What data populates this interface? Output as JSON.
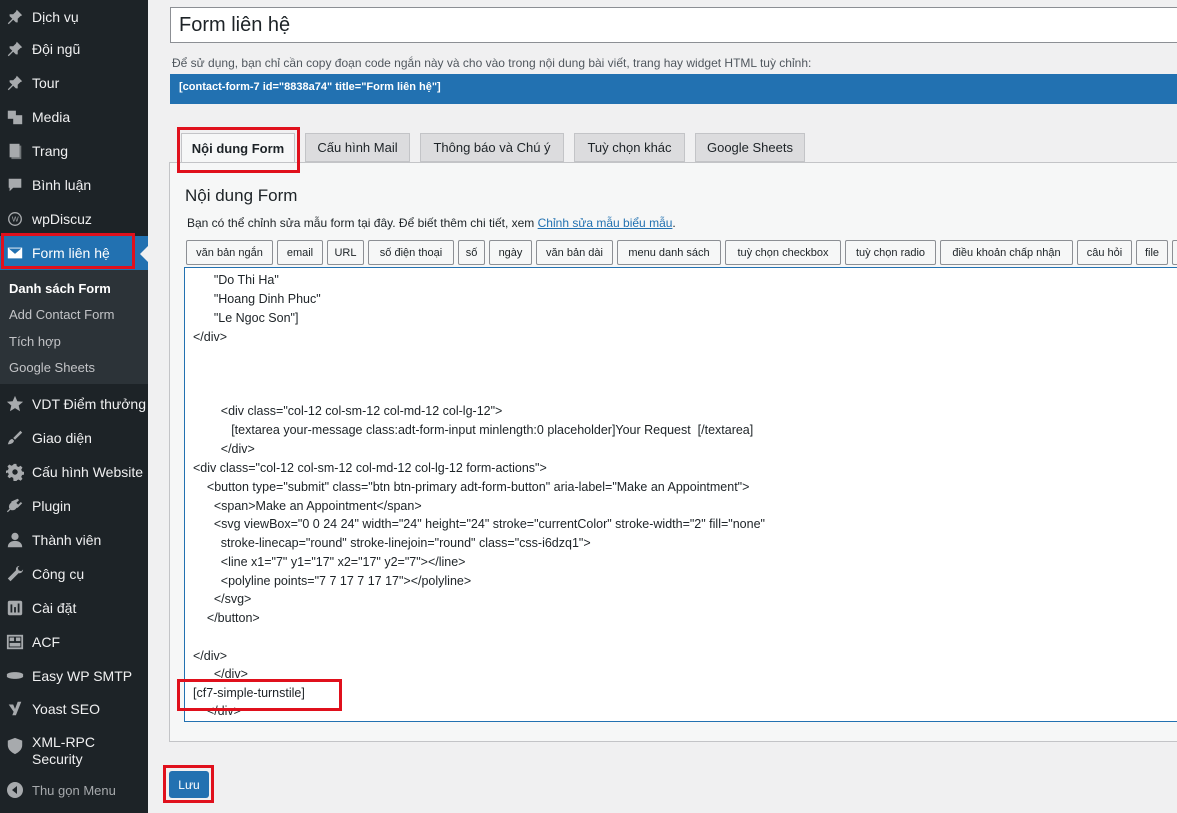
{
  "sidebar": {
    "items": [
      {
        "label": "Dịch vụ",
        "icon": "pin-icon"
      },
      {
        "label": "Đội ngũ",
        "icon": "pin-icon"
      },
      {
        "label": "Tour",
        "icon": "pin-icon"
      },
      {
        "label": "Media",
        "icon": "media-icon"
      },
      {
        "label": "Trang",
        "icon": "page-icon"
      },
      {
        "label": "Bình luận",
        "icon": "comment-icon"
      },
      {
        "label": "wpDiscuz",
        "icon": "wpdiscuz-icon"
      },
      {
        "label": "Form liên hệ",
        "icon": "mail-icon"
      },
      {
        "label": "VDT Điểm thưởng",
        "icon": "star-icon"
      },
      {
        "label": "Giao diện",
        "icon": "brush-icon"
      },
      {
        "label": "Cấu hình Website",
        "icon": "gear-icon"
      },
      {
        "label": "Plugin",
        "icon": "plugin-icon"
      },
      {
        "label": "Thành viên",
        "icon": "user-icon"
      },
      {
        "label": "Công cụ",
        "icon": "wrench-icon"
      },
      {
        "label": "Cài đặt",
        "icon": "settings-icon"
      },
      {
        "label": "ACF",
        "icon": "grid-icon"
      },
      {
        "label": "Easy WP SMTP",
        "icon": "smtp-icon"
      },
      {
        "label": "Yoast SEO",
        "icon": "yoast-icon"
      },
      {
        "label": "XML-RPC Security",
        "icon": "shield-icon"
      }
    ],
    "submenu": [
      "Danh sách Form",
      "Add Contact Form",
      "Tích hợp",
      "Google Sheets"
    ],
    "collapse_label": "Thu gọn Menu"
  },
  "form": {
    "title": "Form liên hệ",
    "shortcode_desc": "Để sử dụng, bạn chỉ cần copy đoạn code ngắn này và cho vào trong nội dung bài viết, trang hay widget HTML tuỳ chỉnh:",
    "shortcode": "[contact-form-7 id=\"8838a74\" title=\"Form liên hệ\"]"
  },
  "tabs": [
    "Nội dung Form",
    "Cấu hình Mail",
    "Thông báo và Chú ý",
    "Tuỳ chọn khác",
    "Google Sheets"
  ],
  "panel": {
    "title": "Nội dung Form",
    "desc_text": "Bạn có thể chỉnh sửa mẫu form tại đây. Để biết thêm chi tiết, xem ",
    "desc_link": "Chỉnh sửa mẫu biểu mẫu",
    "desc_end": "."
  },
  "tag_buttons": [
    "văn bản ngắn",
    "email",
    "URL",
    "số điện thoại",
    "số",
    "ngày",
    "văn bản dài",
    "menu danh sách",
    "tuỳ chọn checkbox",
    "tuỳ chọn radio",
    "điều khoản chấp nhận",
    "câu hỏi",
    "file"
  ],
  "code_lines": [
    "      \"Do Thi Ha\"",
    "      \"Hoang Dinh Phuc\"",
    "      \"Le Ngoc Son\"]",
    "</div>",
    "",
    "",
    "",
    "        <div class=\"col-12 col-sm-12 col-md-12 col-lg-12\">",
    "           [textarea your-message class:adt-form-input minlength:0 placeholder]Your Request  [/textarea]",
    "        </div>",
    "<div class=\"col-12 col-sm-12 col-md-12 col-lg-12 form-actions\">",
    "    <button type=\"submit\" class=\"btn btn-primary adt-form-button\" aria-label=\"Make an Appointment\">",
    "      <span>Make an Appointment</span>",
    "      <svg viewBox=\"0 0 24 24\" width=\"24\" height=\"24\" stroke=\"currentColor\" stroke-width=\"2\" fill=\"none\"",
    "        stroke-linecap=\"round\" stroke-linejoin=\"round\" class=\"css-i6dzq1\">",
    "        <line x1=\"7\" y1=\"17\" x2=\"17\" y2=\"7\"></line>",
    "        <polyline points=\"7 7 17 7 17 17\"></polyline>",
    "      </svg>",
    "    </button>",
    "",
    "</div>",
    "      </div>",
    "[cf7-simple-turnstile]",
    "    </div>"
  ],
  "save_label": "Lưu"
}
